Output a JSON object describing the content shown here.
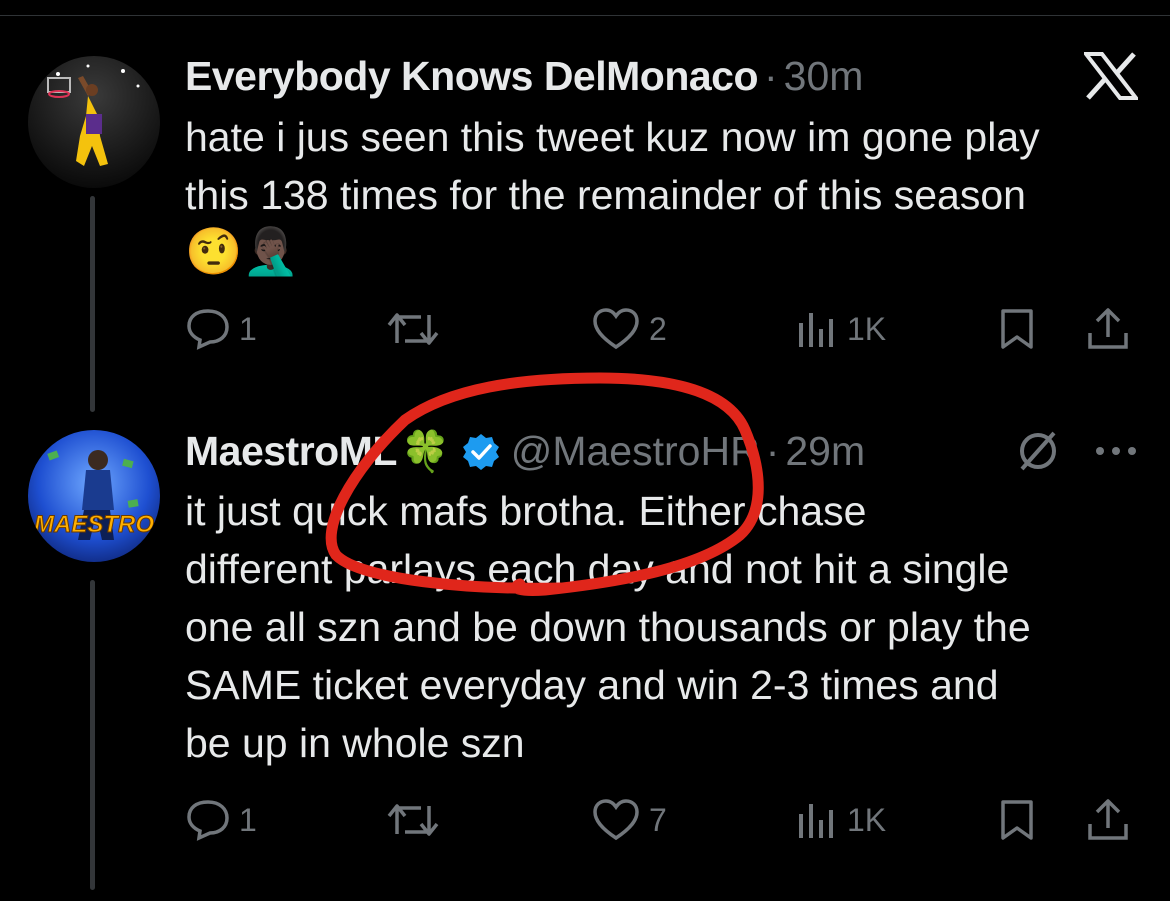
{
  "tweets": [
    {
      "display_name": "Everybody Knows DelMonaco",
      "handle": "",
      "time": "30m",
      "text": "hate i jus seen this tweet kuz now im gone play\nthis 138 times for the remainder of this season",
      "emojis": "🤨🤦🏿‍♂️",
      "replies": "1",
      "retweets": "",
      "likes": "2",
      "views": "1K"
    },
    {
      "display_name": "MaestroML",
      "name_emoji": "🍀",
      "handle": "@MaestroHR",
      "time": "29m",
      "text": "it just quick mafs brotha. Either chase\ndifferent parlays each day and not hit a single\none all szn and be down thousands or play the\nSAME ticket everyday and win 2-3 times and\nbe up in whole szn",
      "replies": "1",
      "retweets": "",
      "likes": "7",
      "views": "1K",
      "avatar_label": "MAESTRO"
    }
  ],
  "sep_dot": "·",
  "colors": {
    "background": "#000000",
    "text": "#e7e9ea",
    "muted": "#71767b",
    "verified": "#1d9bf0",
    "annotation": "#e0261b"
  },
  "icons": [
    "x-logo-icon",
    "reply-icon",
    "retweet-icon",
    "like-icon",
    "views-icon",
    "bookmark-icon",
    "share-icon",
    "verified-badge-icon",
    "grok-icon",
    "more-icon"
  ]
}
